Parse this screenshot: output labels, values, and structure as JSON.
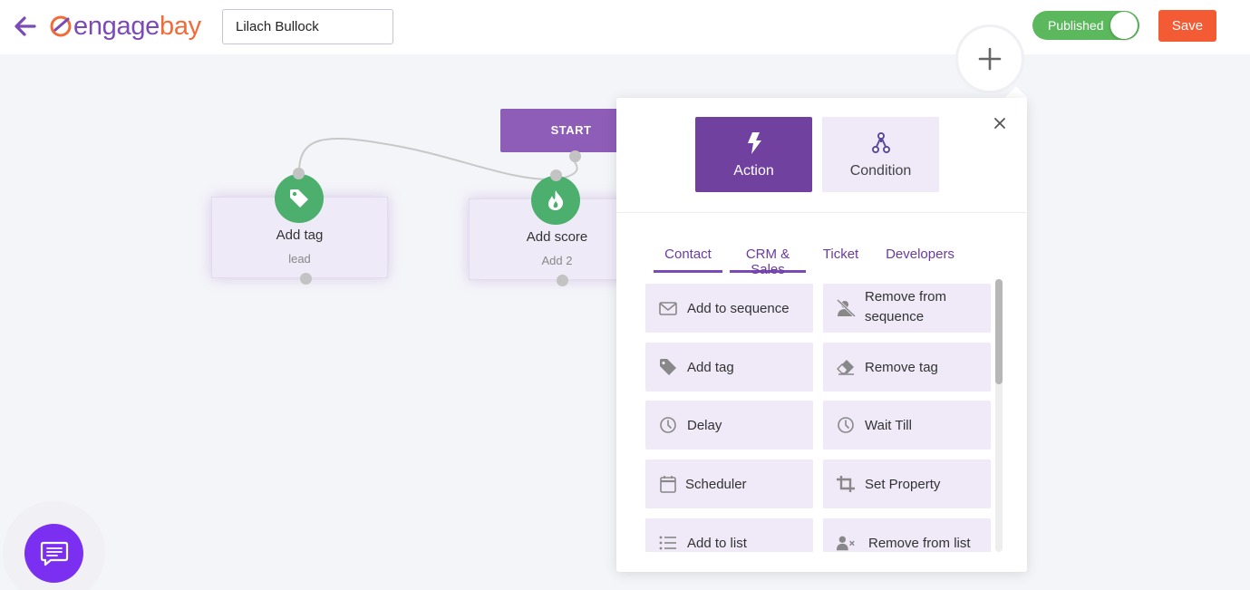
{
  "header": {
    "logo": {
      "part1": "engage",
      "part2": "bay"
    },
    "workflow_name": "Lilach Bullock",
    "publish_label": "Published",
    "publish_state": true,
    "save_label": "Save"
  },
  "canvas": {
    "start_label": "START",
    "nodes": [
      {
        "title": "Add tag",
        "sub": "lead",
        "icon": "tag-icon"
      },
      {
        "title": "Add score",
        "sub": "Add 2",
        "icon": "flame-icon"
      }
    ]
  },
  "panel": {
    "types": [
      {
        "label": "Action",
        "icon": "lightning-icon",
        "active": true
      },
      {
        "label": "Condition",
        "icon": "branch-icon",
        "active": false
      }
    ],
    "tabs": [
      {
        "label": "Contact",
        "active": true
      },
      {
        "label": "CRM & Sales",
        "active": true
      },
      {
        "label": "Ticket",
        "active": false
      },
      {
        "label": "Developers",
        "active": false
      }
    ],
    "items": [
      {
        "label": "Add to sequence",
        "icon": "envelope-icon"
      },
      {
        "label": "Remove from sequence",
        "icon": "user-remove-icon"
      },
      {
        "label": "Add tag",
        "icon": "tag-icon"
      },
      {
        "label": "Remove tag",
        "icon": "eraser-icon"
      },
      {
        "label": "Delay",
        "icon": "clock-icon"
      },
      {
        "label": "Wait Till",
        "icon": "clock-icon"
      },
      {
        "label": "Scheduler",
        "icon": "calendar-icon"
      },
      {
        "label": "Set Property",
        "icon": "crop-icon"
      },
      {
        "label": "Add to list",
        "icon": "list-icon"
      },
      {
        "label": "Remove from list",
        "icon": "user-x-icon"
      }
    ]
  },
  "colors": {
    "brand_purple": "#70419f",
    "brand_orange": "#f35b34",
    "node_green": "#4caf6e",
    "toggle_green": "#5cb85c",
    "chat_purple": "#7b2ff0"
  }
}
